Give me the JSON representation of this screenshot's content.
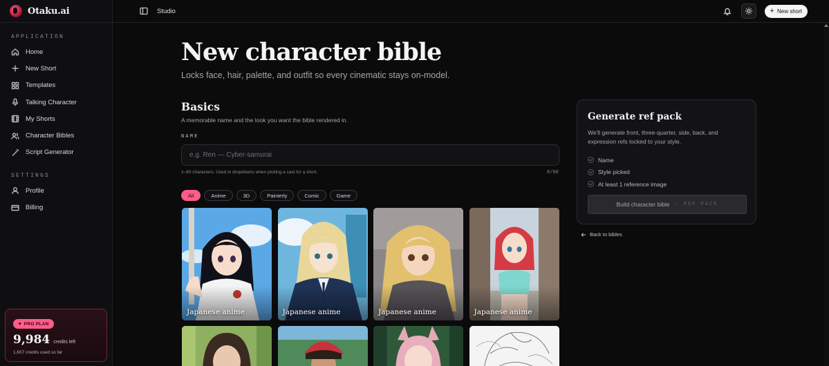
{
  "app": {
    "name": "Otaku.ai"
  },
  "sidebar": {
    "application_label": "APPLICATION",
    "settings_label": "SETTINGS",
    "app_items": [
      {
        "label": "Home",
        "icon": "home-icon"
      },
      {
        "label": "New Short",
        "icon": "plus-icon"
      },
      {
        "label": "Templates",
        "icon": "grid-icon"
      },
      {
        "label": "Talking Character",
        "icon": "mic-icon"
      },
      {
        "label": "My Shorts",
        "icon": "film-icon"
      },
      {
        "label": "Character Bibles",
        "icon": "users-icon"
      },
      {
        "label": "Script Generator",
        "icon": "wand-icon"
      }
    ],
    "settings_items": [
      {
        "label": "Profile",
        "icon": "user-icon"
      },
      {
        "label": "Billing",
        "icon": "card-icon"
      }
    ],
    "plan": {
      "badge": "PRO PLAN",
      "credits": "9,984",
      "credits_label": "credits left",
      "used": "1,607 credits used so far"
    }
  },
  "topbar": {
    "breadcrumb": "Studio",
    "new_short": "New short"
  },
  "main": {
    "title": "New character bible",
    "subtitle": "Locks face, hair, palette, and outfit so every cinematic stays on-model.",
    "basics_title": "Basics",
    "basics_sub": "A memorable name and the look you want the bible rendered in.",
    "name_label": "NAME",
    "name_placeholder": "e.g. Ren — Cyber-samurai",
    "name_value": "",
    "name_help": "1–60 characters. Used in dropdowns when picking a cast for a short.",
    "name_count": "0/60",
    "filters": [
      "All",
      "Anime",
      "3D",
      "Painterly",
      "Comic",
      "Game"
    ],
    "active_filter": "All",
    "styles": [
      {
        "caption": "Japanese anime"
      },
      {
        "caption": "Japanese anime"
      },
      {
        "caption": "Japanese anime"
      },
      {
        "caption": "Japanese anime"
      },
      {
        "caption": ""
      },
      {
        "caption": ""
      },
      {
        "caption": ""
      },
      {
        "caption": ""
      }
    ]
  },
  "ref_pack": {
    "title": "Generate ref pack",
    "description": "We'll generate front, three-quarter, side, back, and expression refs locked to your style.",
    "checklist": [
      "Name",
      "Style picked",
      "At least 1 reference image"
    ],
    "build_label": "Build character bible",
    "build_suffix": "→ REF PACK",
    "back_link": "Back to bibles"
  }
}
